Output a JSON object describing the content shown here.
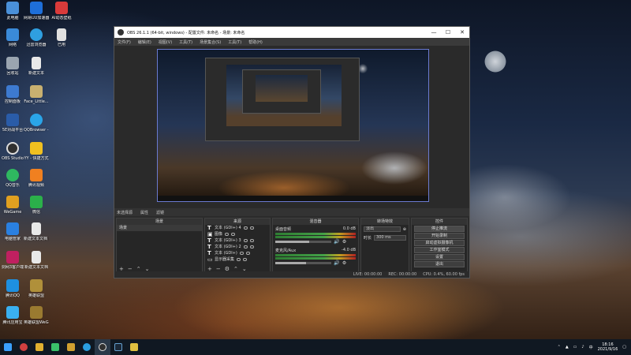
{
  "desktop": {
    "icons": [
      {
        "label": "此电脑",
        "color": "#4a90d9"
      },
      {
        "label": "网易UU加速器",
        "color": "#1e6fd9"
      },
      {
        "label": "AI动态壁纸",
        "color": "#d93a3a"
      },
      {
        "label": "网络",
        "color": "#3a8ad9"
      },
      {
        "label": "迅雷浏览器",
        "color": "#2f9fe0"
      },
      {
        "label": "已用",
        "color": "#e0e0e0"
      },
      {
        "label": "回收站",
        "color": "#9aa5b0"
      },
      {
        "label": "新建文本",
        "color": "#e8e8e8"
      },
      {
        "label": "控制面板",
        "color": "#3d7ad0"
      },
      {
        "label": "Face_Little...",
        "color": "#c8b070"
      },
      {
        "label": "5E对战平台",
        "color": "#2a5ca8"
      },
      {
        "label": "QQBrowser - 快捷方式",
        "color": "#2aa5e8"
      },
      {
        "label": "OBS Studio",
        "color": "#303030"
      },
      {
        "label": "YY - 快捷方式",
        "color": "#f0c020"
      },
      {
        "label": "QQ音乐",
        "color": "#2fb860"
      },
      {
        "label": "腾讯视频",
        "color": "#f08020"
      },
      {
        "label": "WeGame",
        "color": "#e0a020"
      },
      {
        "label": "微信",
        "color": "#2bb04a"
      },
      {
        "label": "电脑管家",
        "color": "#2a80e0"
      },
      {
        "label": "新建文本文档 (2)",
        "color": "#e8e8e8"
      },
      {
        "label": "剑网3客户端",
        "color": "#c02060"
      },
      {
        "label": "新建文本文档",
        "color": "#e8e8e8"
      },
      {
        "label": "腾讯QQ",
        "color": "#1e90e0"
      },
      {
        "label": "英雄联盟",
        "color": "#b0903a"
      },
      {
        "label": "腾讯应用宝",
        "color": "#3ab0f0"
      },
      {
        "label": "英雄联盟WeGame版",
        "color": "#9a7a30"
      }
    ]
  },
  "obs": {
    "title": "OBS 26.1.1 (64-bit, windows) - 配置文件: 未命名 - 场景: 未命名",
    "menu": [
      "文件(F)",
      "编辑(E)",
      "视图(V)",
      "工具(T)",
      "场景集合(S)",
      "工具(T)",
      "帮助(H)"
    ],
    "dock_tabs": [
      "未选择源",
      "属性",
      "滤镜"
    ],
    "scenes": {
      "header": "场景",
      "items": [
        "场景"
      ]
    },
    "sources": {
      "header": "来源",
      "items": [
        {
          "label": "文本 (GDI+) 4"
        },
        {
          "label": "图像"
        },
        {
          "label": "文本 (GDI+) 3"
        },
        {
          "label": "文本 (GDI+) 2"
        },
        {
          "label": "文本 (GDI+)"
        },
        {
          "label": "显示器采集"
        }
      ]
    },
    "mixer": {
      "header": "混音器",
      "channels": [
        {
          "name": "桌面音频",
          "db": "0.0 dB",
          "level": 0.6
        },
        {
          "name": "麦克风/Aux",
          "db": "-4.0 dB",
          "level": 0.55
        }
      ]
    },
    "transitions": {
      "header": "转场特效",
      "type": "淡出",
      "duration_label": "时长",
      "duration": "300 ms"
    },
    "controls": {
      "header": "控件",
      "buttons": [
        "停止推流",
        "开始录制",
        "启动虚拟摄像机",
        "工作室模式",
        "设置",
        "退出"
      ]
    },
    "status": {
      "live": "LIVE: 00:00:00",
      "rec": "REC: 00:00:00",
      "cpu": "CPU: 0.4%, 60.00 fps"
    }
  },
  "taskbar": {
    "icons": [
      "windows-icon",
      "search-icon",
      "folder-icon",
      "media-icon",
      "game-icon",
      "browser-icon",
      "obs-icon",
      "steam-icon",
      "app-icon"
    ],
    "time": "18:16",
    "date": "2021/9/16"
  }
}
